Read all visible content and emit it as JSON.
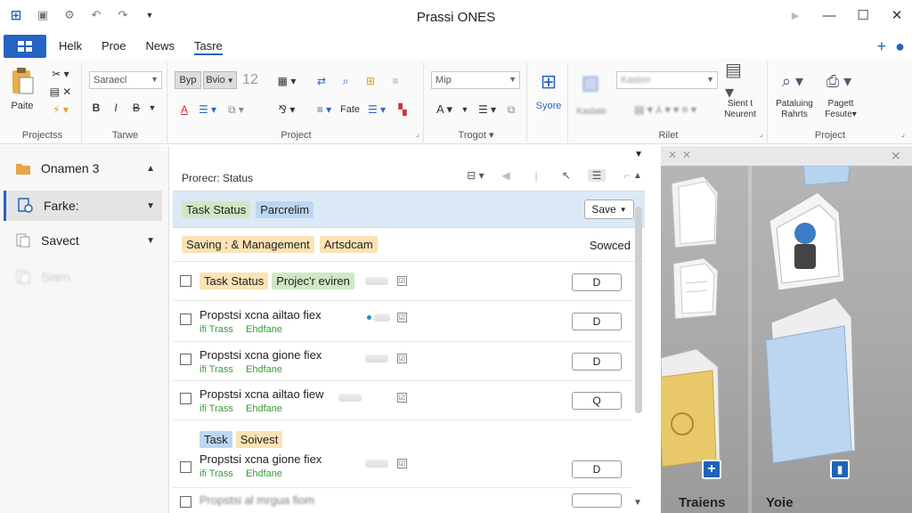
{
  "window": {
    "title": "Prassi ONES"
  },
  "menu": {
    "file_icon": "grid-icon",
    "tabs": [
      {
        "label": "Helk"
      },
      {
        "label": "Proe"
      },
      {
        "label": "News"
      },
      {
        "label": "Tasre"
      }
    ],
    "active_tab_index": 3
  },
  "ribbon": {
    "groups": [
      {
        "label": "Projectss"
      },
      {
        "label": "Tarwe"
      },
      {
        "label": "Project"
      },
      {
        "label": "Trogot"
      },
      {
        "label": "Rilet"
      },
      {
        "label": "Project"
      }
    ],
    "paste_label": "Paite",
    "font_name": "Saraecl",
    "font_size": "12",
    "btn_a_label": "Byp",
    "btn_b_label": "Bvio",
    "bold_label": "B",
    "italic_label": "I",
    "strike_label": "B",
    "style_combo": "Mip",
    "font_color_label": "A",
    "fate_label": "Fate",
    "syore_label": "Syore",
    "kaslate_label": "Kaslate",
    "rilet_combo": "Kaslon",
    "sient_label_1": "Sient t",
    "sient_label_2": "Neurent",
    "pataluing_label_1": "Pataluing",
    "pataluing_label_2": "Rahrts",
    "pagett_label_1": "Pagett",
    "pagett_label_2": "Fesute"
  },
  "sidebar": {
    "items": [
      {
        "label": "Onamen 3",
        "icon": "folder-icon"
      },
      {
        "label": "Farke:",
        "icon": "task-search-icon"
      },
      {
        "label": "Savect",
        "icon": "document-icon"
      },
      {
        "label": "Siarn",
        "icon": "document-icon"
      }
    ],
    "selected_index": 1
  },
  "main": {
    "header_label": "Prorecr: Status",
    "band1": {
      "tags": [
        {
          "label": "Task Status"
        },
        {
          "label": "Parcrelim"
        }
      ],
      "save_label": "Save"
    },
    "band2": {
      "tags": [
        {
          "label": "Saving : & Management"
        },
        {
          "label": "Artsdcam"
        }
      ],
      "saved_label": "Sowced"
    },
    "rows": [
      {
        "title_tags": [
          {
            "label": "Task Status"
          },
          {
            "label": "Projec'r eviren"
          }
        ],
        "button": "D"
      },
      {
        "title": "Propstsi xcna ailtao fiex",
        "sub_1": "ifi Trass",
        "sub_2": "Ehdfane",
        "button": "D"
      },
      {
        "title": "Propstsi xcna gione fiex",
        "sub_1": "ifi Trass",
        "sub_2": "Ehdfane",
        "button": "D"
      },
      {
        "title": "Propstsi xcna ailtao fiew",
        "sub_1": "ifi Trass",
        "sub_2": "Ehdfane",
        "button": "Q"
      },
      {
        "title": "Propstsi xcna gione fiex",
        "sub_1": "ifi Trass",
        "sub_2": "Ehdfane",
        "button": "D"
      },
      {
        "title": "Propstsi al mrgua fiom"
      }
    ],
    "section_tags": [
      {
        "label": "Task"
      },
      {
        "label": "Soivest"
      }
    ]
  },
  "preview": {
    "label_left": "Traiens",
    "label_right": "Yoie"
  },
  "colors": {
    "accent": "#2563c4",
    "band_blue": "#dbe9f7",
    "tag_green": "#cfe8c4",
    "tag_blue": "#bcd7f2",
    "tag_amber": "#fbe3b4"
  }
}
